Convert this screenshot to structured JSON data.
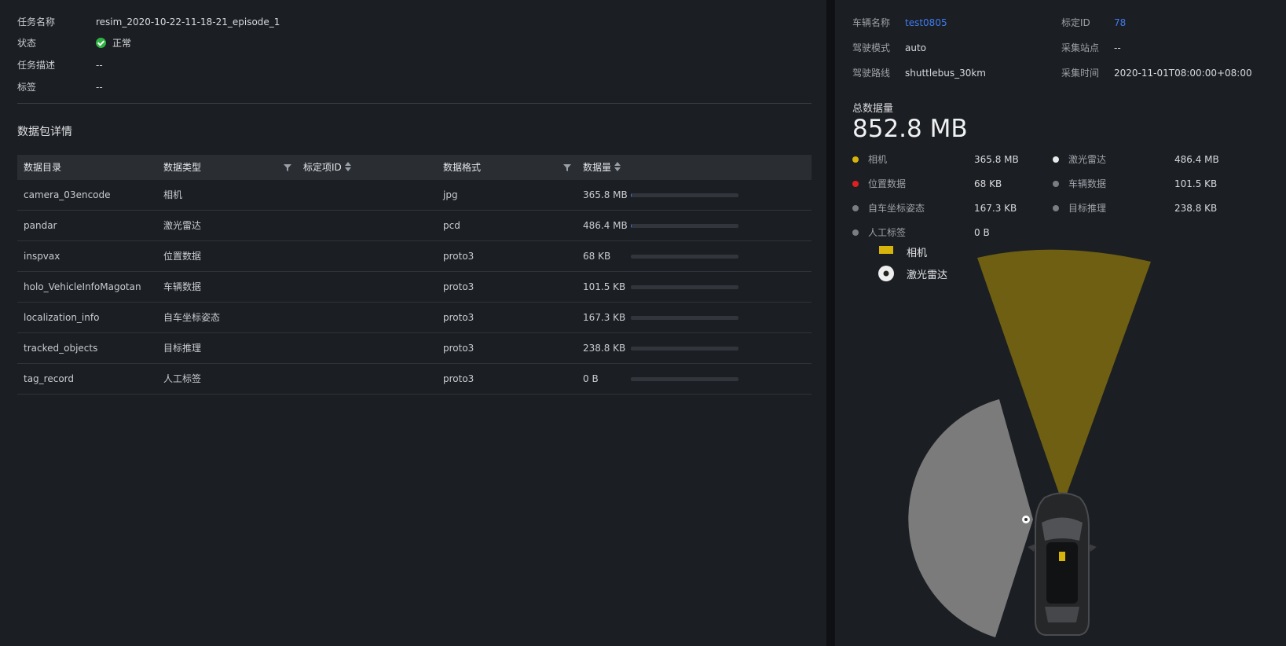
{
  "task": {
    "rows": [
      {
        "key": "任务名称",
        "value": "resim_2020-10-22-11-18-21_episode_1"
      },
      {
        "key": "状态",
        "value": "正常"
      },
      {
        "key": "任务描述",
        "value": "--"
      },
      {
        "key": "标签",
        "value": "--"
      }
    ],
    "status_color": "#2fb344"
  },
  "package": {
    "title": "数据包详情",
    "columns": [
      "数据目录",
      "数据类型",
      "标定项ID",
      "数据格式",
      "数据量"
    ],
    "rows": [
      {
        "dir": "camera_03encode",
        "type": "相机",
        "calib": "",
        "format": "jpg",
        "size": "365.8 MB",
        "fraction": 0.01
      },
      {
        "dir": "pandar",
        "type": "激光雷达",
        "calib": "",
        "format": "pcd",
        "size": "486.4 MB",
        "fraction": 0.01
      },
      {
        "dir": "inspvax",
        "type": "位置数据",
        "calib": "",
        "format": "proto3",
        "size": "68 KB",
        "fraction": 0
      },
      {
        "dir": "holo_VehicleInfoMagotan",
        "type": "车辆数据",
        "calib": "",
        "format": "proto3",
        "size": "101.5 KB",
        "fraction": 0
      },
      {
        "dir": "localization_info",
        "type": "自车坐标姿态",
        "calib": "",
        "format": "proto3",
        "size": "167.3 KB",
        "fraction": 0
      },
      {
        "dir": "tracked_objects",
        "type": "目标推理",
        "calib": "",
        "format": "proto3",
        "size": "238.8 KB",
        "fraction": 0
      },
      {
        "dir": "tag_record",
        "type": "人工标签",
        "calib": "",
        "format": "proto3",
        "size": "0 B",
        "fraction": 0
      }
    ]
  },
  "vehicle": {
    "name_label": "车辆名称",
    "name": "test0805",
    "calib_label": "标定ID",
    "calib": "78",
    "mode_label": "驾驶模式",
    "mode": "auto",
    "site_label": "采集站点",
    "site": "--",
    "route_label": "驾驶路线",
    "route": "shuttlebus_30km",
    "time_label": "采集时间",
    "time": "2020-11-01T08:00:00+08:00"
  },
  "total": {
    "label": "总数据量",
    "value": "852.8 MB"
  },
  "breakdown": [
    {
      "name": "相机",
      "size": "365.8 MB",
      "color": "#d7b40c"
    },
    {
      "name": "激光雷达",
      "size": "486.4 MB",
      "color": "#e8e8e8"
    },
    {
      "name": "位置数据",
      "size": "68 KB",
      "color": "#e02020"
    },
    {
      "name": "车辆数据",
      "size": "101.5 KB",
      "color": "#7a7d82"
    },
    {
      "name": "自车坐标姿态",
      "size": "167.3 KB",
      "color": "#7a7d82"
    },
    {
      "name": "目标推理",
      "size": "238.8 KB",
      "color": "#7a7d82"
    },
    {
      "name": "人工标签",
      "size": "0 B",
      "color": "#7a7d82"
    }
  ],
  "sensor_legend": {
    "camera": "相机",
    "lidar": "激光雷达",
    "camera_color": "#d7b40c",
    "camera_fov_color": "#6e5f12",
    "lidar_fov_color": "#7b7b7b"
  }
}
